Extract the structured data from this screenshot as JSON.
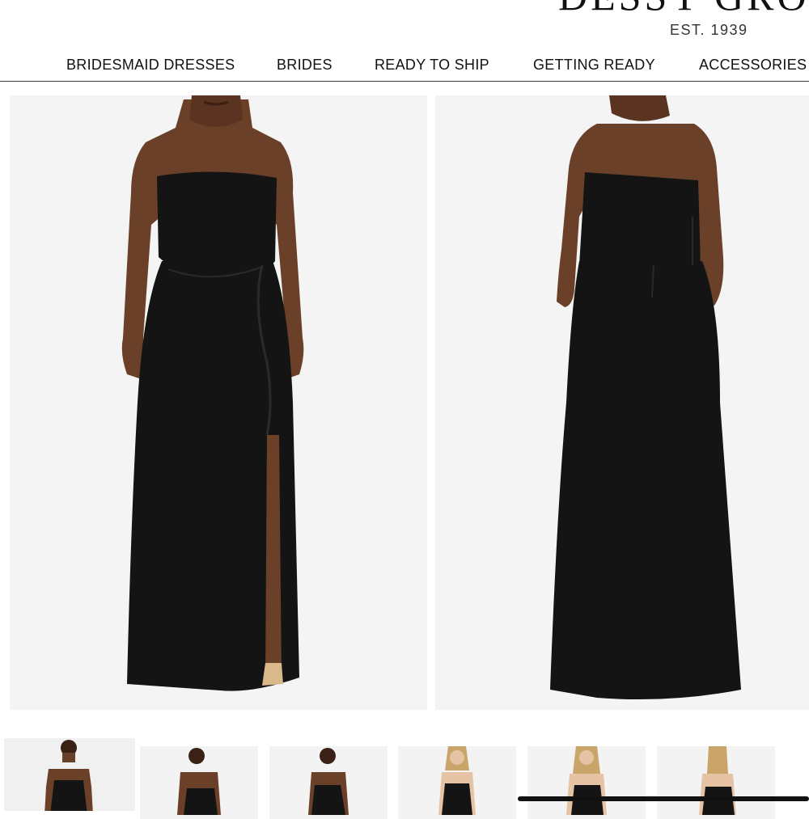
{
  "header": {
    "brand_partial": "DESSY GROUP",
    "established": "EST. 1939"
  },
  "nav": {
    "items": [
      {
        "label": "BRIDESMAID DRESSES"
      },
      {
        "label": "BRIDES"
      },
      {
        "label": "READY TO SHIP"
      },
      {
        "label": "GETTING READY"
      },
      {
        "label": "ACCESSORIES"
      }
    ]
  },
  "gallery": {
    "main_images": [
      {
        "view": "front",
        "dress_color": "#141414"
      },
      {
        "view": "back",
        "dress_color": "#141414"
      }
    ],
    "thumbnails": [
      {
        "view": "front",
        "selected": true
      },
      {
        "view": "back",
        "selected": false
      },
      {
        "view": "front-alt",
        "selected": false
      },
      {
        "view": "front",
        "selected": false
      },
      {
        "view": "back",
        "selected": false
      },
      {
        "view": "back-side",
        "selected": false
      }
    ]
  },
  "colors": {
    "background": "#ffffff",
    "photo_bg": "#f4f4f4",
    "dress": "#141414",
    "skin_dark": "#6b4028",
    "skin_light": "#e6c3a4",
    "hair_blonde": "#c9a56a"
  }
}
